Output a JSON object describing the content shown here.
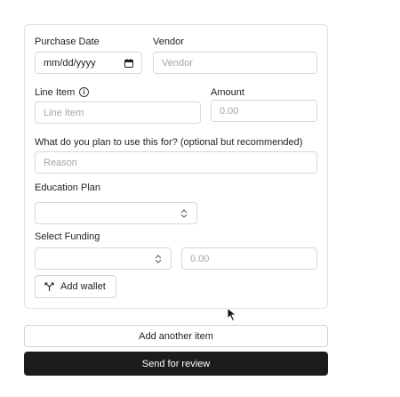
{
  "form": {
    "purchase_date": {
      "label": "Purchase Date",
      "value": "mm/dd/yyyy"
    },
    "vendor": {
      "label": "Vendor",
      "placeholder": "Vendor"
    },
    "line_item": {
      "label": "Line Item",
      "placeholder": "Line Item",
      "info_icon": "info-icon"
    },
    "amount": {
      "label": "Amount",
      "placeholder": "0.00"
    },
    "reason": {
      "label": "What do you plan to use this for? (optional but recommended)",
      "placeholder": "Reason"
    },
    "education_plan": {
      "label": "Education Plan",
      "value": ""
    },
    "funding": {
      "label": "Select Funding",
      "value": "",
      "amount_placeholder": "0.00"
    },
    "add_wallet_label": "Add wallet"
  },
  "actions": {
    "add_another_label": "Add another item",
    "send_review_label": "Send for review"
  },
  "colors": {
    "primary_button": "#1c1c1c",
    "border": "#d7d7dc"
  }
}
